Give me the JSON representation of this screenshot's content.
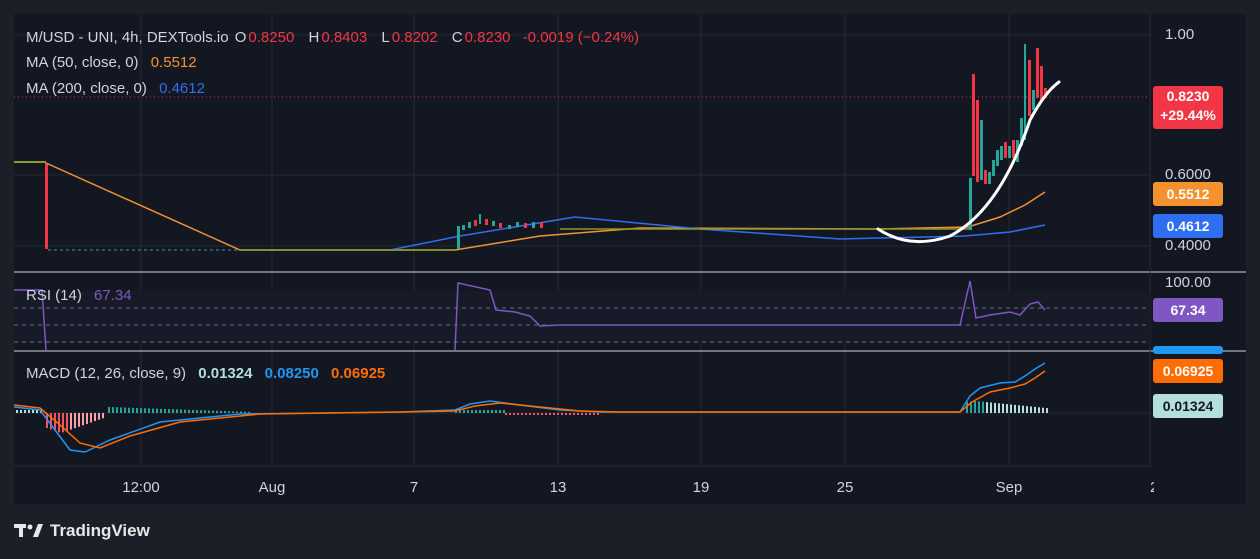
{
  "header": {
    "symbol": "M/USD - UNI, 4h, DEXTools.io",
    "o_label": "O",
    "o_value": "0.8250",
    "h_label": "H",
    "h_value": "0.8403",
    "l_label": "L",
    "l_value": "0.8202",
    "c_label": "C",
    "c_value": "0.8230",
    "change": "-0.0019 (−0.24%)"
  },
  "ma50": {
    "label": "MA (50, close, 0)",
    "value": "0.5512",
    "color": "#f5922f"
  },
  "ma200": {
    "label": "MA (200, close, 0)",
    "value": "0.4612",
    "color": "#2e6ff2"
  },
  "price_badge": {
    "value": "0.8230",
    "change": "+29.44%",
    "color": "#f23645"
  },
  "price_axis": [
    "1.00",
    "0.6000",
    "0.4000"
  ],
  "rsi": {
    "label": "RSI (14)",
    "value": "67.34",
    "color": "#7e57c2",
    "axis_top": "100.00"
  },
  "macd": {
    "label": "MACD (12, 26, close, 9)",
    "hist": "0.01324",
    "macd": "0.08250",
    "signal": "0.06925",
    "hist_color": "#b2dfdb",
    "macd_color": "#2196f3",
    "signal_color": "#ff6d00"
  },
  "x_axis": [
    "12:00",
    "Aug",
    "7",
    "13",
    "19",
    "25",
    "Sep",
    "2"
  ],
  "brand": "TradingView",
  "chart_data": [
    {
      "type": "line",
      "title": "M/USD - UNI, 4h",
      "x": [
        "12:00",
        "Aug",
        "7",
        "13",
        "19",
        "25",
        "Sep"
      ],
      "series": [
        {
          "name": "MA (50, close, 0)",
          "values": [
            0.65,
            0.38,
            0.38,
            0.42,
            0.44,
            0.44,
            0.55
          ]
        },
        {
          "name": "MA (200, close, 0)",
          "values": [
            0.65,
            0.38,
            0.38,
            0.47,
            0.44,
            0.41,
            0.46
          ]
        }
      ],
      "last_close": 0.823,
      "ylim": [
        0.35,
        1.0
      ]
    },
    {
      "type": "line",
      "title": "RSI (14)",
      "series": [
        {
          "name": "RSI (14)",
          "last": 67.34
        }
      ],
      "ylim": [
        0,
        100
      ]
    },
    {
      "type": "bar",
      "title": "MACD (12, 26, close, 9)",
      "series": [
        {
          "name": "Histogram",
          "last": 0.01324
        },
        {
          "name": "MACD",
          "last": 0.0825
        },
        {
          "name": "Signal",
          "last": 0.06925
        }
      ]
    }
  ]
}
